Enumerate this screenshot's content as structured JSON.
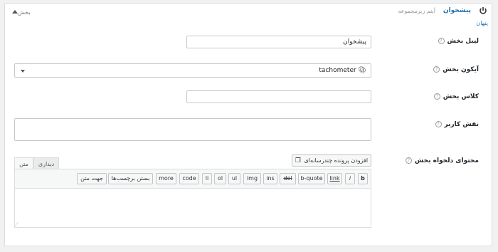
{
  "header": {
    "title": "پیشخوان",
    "subtitle": "آیتم زیرمجموعه",
    "hidden_link": "پنهان",
    "collapse_label": "بخش"
  },
  "fields": {
    "label": {
      "label": "لیبل بخش",
      "value": "پیشخوان"
    },
    "icon": {
      "label": "آیکون بخش",
      "value": "tachometer"
    },
    "css_class": {
      "label": "کلاس بخش",
      "value": ""
    },
    "user_role": {
      "label": "نقش کاربر",
      "value": ""
    },
    "custom_content": {
      "label": "محتوای دلخواه بخش"
    }
  },
  "editor": {
    "add_media": "افزودن پرونده چندرسانه‌ای",
    "tab_visual": "دیداری",
    "tab_text": "متن",
    "toolbar": [
      "b",
      "i",
      "link",
      "b-quote",
      "del",
      "ins",
      "img",
      "ul",
      "ol",
      "li",
      "code",
      "more",
      "بستن برچسب‌ها",
      "جهت متن"
    ],
    "content": ""
  },
  "help_glyph": "?",
  "colors": {
    "link": "#2271b1",
    "border": "#c8c8c8"
  }
}
